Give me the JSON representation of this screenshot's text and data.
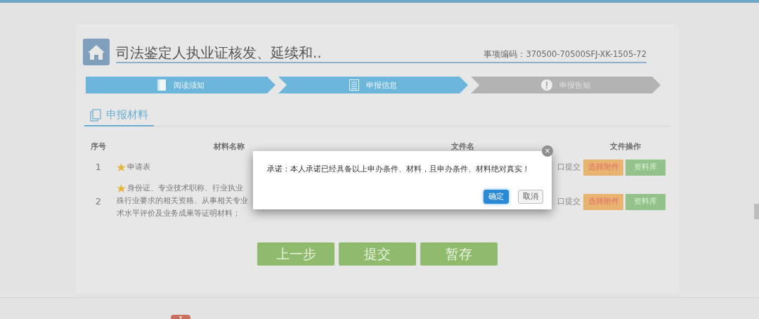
{
  "header": {
    "title": "司法鉴定人执业证核发、延续和..",
    "code": "事项编码：370500-70500SFJ-XK-1505-72"
  },
  "steps": [
    {
      "label": "阅读须知",
      "done": true,
      "kind": "book"
    },
    {
      "label": "申报信息",
      "done": true,
      "kind": "form"
    },
    {
      "label": "申报告知",
      "done": false,
      "kind": "alert"
    }
  ],
  "section_tab": {
    "label": "申报材料",
    "selected": true
  },
  "table": {
    "columns": [
      "序号",
      "材料名称",
      "文件名",
      "文件操作"
    ],
    "rows": [
      {
        "number": "1",
        "required": true,
        "name_lines": [
          "申请表"
        ],
        "file_status": "口提交",
        "actions": [
          "选择附件",
          "资料库"
        ]
      },
      {
        "number": "2",
        "required": true,
        "name_lines": [
          "身份证、专业技术职称、行业执业",
          "殊行业要求的相关资格、从事相关专业",
          "术水平评价及业务成果等证明材料；"
        ],
        "file_status": "口提交",
        "actions": [
          "选择附件",
          "资料库"
        ]
      }
    ]
  },
  "buttons": [
    "上一步",
    "提交",
    "暂存"
  ],
  "dialog": {
    "message": "承诺：本人承诺已经具备以上申办条件、材料，且申办条件、材料绝对真实！",
    "close": "×",
    "buttons": [
      {
        "label": "确定",
        "kind": "primary"
      },
      {
        "label": "取消",
        "kind": "default"
      }
    ]
  }
}
